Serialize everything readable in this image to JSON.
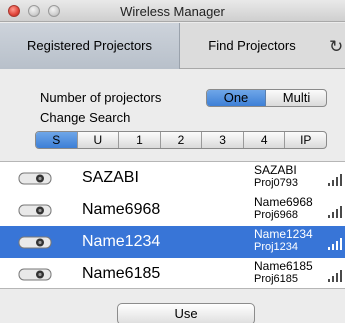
{
  "window": {
    "title": "Wireless Manager"
  },
  "tabs": [
    {
      "label": "Registered Projectors",
      "active": true
    },
    {
      "label": "Find Projectors",
      "active": false
    }
  ],
  "refresh_icon": "refresh-icon",
  "options": {
    "count_label": "Number of projectors",
    "count_options": [
      "One",
      "Multi"
    ],
    "count_selected": "One",
    "search_label": "Change Search",
    "search_options": [
      "S",
      "U",
      "1",
      "2",
      "3",
      "4",
      "IP"
    ],
    "search_selected": "S"
  },
  "projectors": [
    {
      "name": "SAZABI",
      "model": "SAZABI",
      "id": "Proj0793",
      "selected": false
    },
    {
      "name": "Name6968",
      "model": "Name6968",
      "id": "Proj6968",
      "selected": false
    },
    {
      "name": "Name1234",
      "model": "Name1234",
      "id": "Proj1234",
      "selected": true
    },
    {
      "name": "Name6185",
      "model": "Name6185",
      "id": "Proj6185",
      "selected": false
    }
  ],
  "footer": {
    "use_label": "Use"
  },
  "colors": {
    "selection": "#3875d7",
    "segment_selected": "#5b93e0"
  }
}
